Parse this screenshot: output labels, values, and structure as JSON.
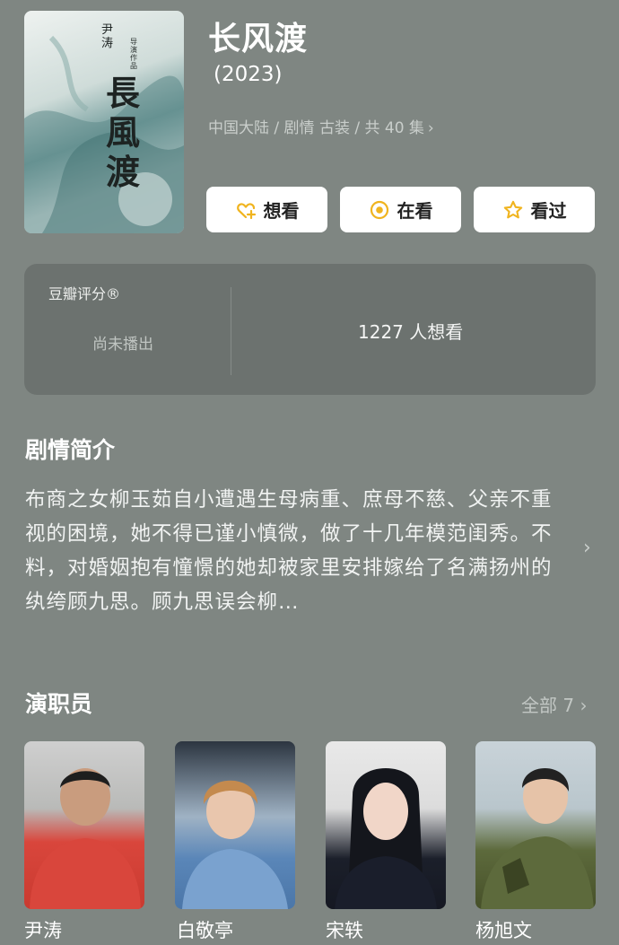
{
  "poster": {
    "calligraphy": "長風渡",
    "small_text": "尹涛",
    "small_text2": "导演作品"
  },
  "header": {
    "title": "长风渡",
    "year": "(2023)",
    "meta": "中国大陆 / 剧情 古装 / 共 40 集",
    "meta_chevron": "›"
  },
  "actions": {
    "want_label": "想看",
    "watching_label": "在看",
    "watched_label": "看过"
  },
  "rating": {
    "label": "豆瓣评分®",
    "status": "尚未播出",
    "wish_count": "1227 人想看"
  },
  "synopsis": {
    "title": "剧情简介",
    "text": "布商之女柳玉茹自小遭遇生母病重、庶母不慈、父亲不重视的困境，她不得已谨小慎微，做了十几年模范闺秀。不料，对婚姻抱有憧憬的她却被家里安排嫁给了名满扬州的纨绔顾九思。顾九思误会柳…",
    "chevron": "›"
  },
  "cast": {
    "title": "演职员",
    "all_label": "全部 7 ›",
    "members": [
      {
        "name": "尹涛"
      },
      {
        "name": "白敬亭"
      },
      {
        "name": "宋轶"
      },
      {
        "name": "杨旭文"
      }
    ]
  },
  "colors": {
    "background": "#7f8682",
    "card": "#6c726f",
    "accent": "#f0b41f"
  }
}
